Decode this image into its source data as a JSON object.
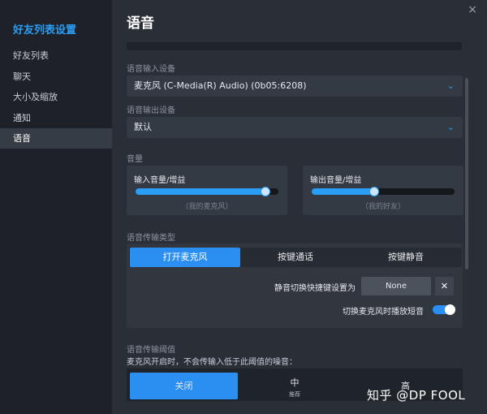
{
  "sidebar": {
    "title": "好友列表设置",
    "items": [
      {
        "label": "好友列表"
      },
      {
        "label": "聊天"
      },
      {
        "label": "大小及缩放"
      },
      {
        "label": "通知"
      },
      {
        "label": "语音"
      }
    ]
  },
  "main": {
    "title": "语音",
    "close": "×",
    "input_device": {
      "label": "语音输入设备",
      "value": "麦克风 (C-Media(R) Audio) (0b05:6208)"
    },
    "output_device": {
      "label": "语音输出设备",
      "value": "默认"
    },
    "chevron": "⌄",
    "volume": {
      "label": "音量",
      "input": {
        "label": "输入音量/增益",
        "hint": "（我的麦克风）",
        "level": 0.91
      },
      "output": {
        "label": "输出音量/增益",
        "hint": "（我的好友）",
        "level": 0.44
      }
    },
    "transmission": {
      "label": "语音传输类型",
      "options": [
        "打开麦克风",
        "按键通话",
        "按键静音"
      ],
      "selected": 0,
      "mute_toggle_label": "静音切换快捷键设置为",
      "mute_key": "None",
      "clear": "✕",
      "play_tone_label": "切换麦克风时播放短音",
      "play_tone_on": true
    },
    "threshold": {
      "label": "语音传输阈值",
      "desc": "麦克风开启时，不会传输入低于此阈值的噪音：",
      "options": [
        {
          "label": "关闭",
          "sub": ""
        },
        {
          "label": "中",
          "sub": "推荐"
        },
        {
          "label": "高",
          "sub": ""
        }
      ],
      "selected": 0
    }
  },
  "watermark": "知乎 @DP FOOL",
  "colors": {
    "accent": "#2a9df4",
    "sidebar_bg": "#1e2228",
    "main_bg": "#2a2e36"
  }
}
